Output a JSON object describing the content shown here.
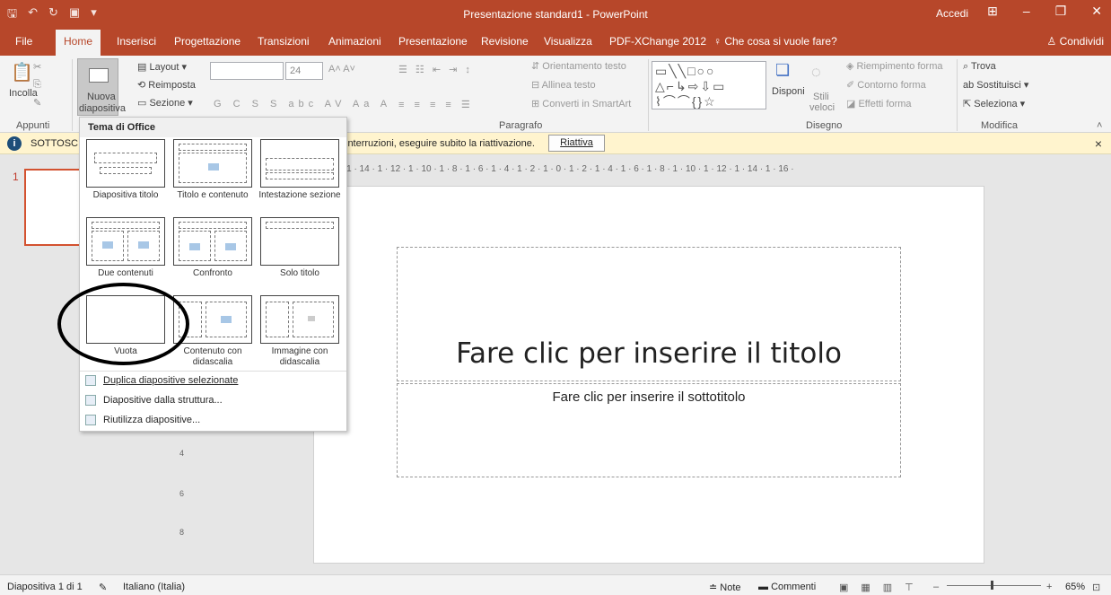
{
  "window": {
    "title": "Presentazione standard1 - PowerPoint",
    "signin": "Accedi"
  },
  "tabs": [
    "File",
    "Home",
    "Inserisci",
    "Progettazione",
    "Transizioni",
    "Animazioni",
    "Presentazione",
    "Revisione",
    "Visualizza",
    "PDF-XChange 2012",
    "Che cosa si vuole fare?"
  ],
  "share": "Condividi",
  "ribbon": {
    "paste": "Incolla",
    "new_slide_1": "Nuova",
    "new_slide_2": "diapositiva",
    "layout": "Layout",
    "reset": "Reimposta",
    "section": "Sezione",
    "font_size": "24",
    "text_dir": "Orientamento testo",
    "align_text": "Allinea testo",
    "smartart": "Converti in SmartArt",
    "arrange": "Disponi",
    "quick_styles_1": "Stili",
    "quick_styles_2": "veloci",
    "fill": "Riempimento forma",
    "outline": "Contorno forma",
    "effects": "Effetti forma",
    "find": "Trova",
    "replace": "Sostituisci",
    "select": "Seleziona",
    "groups": {
      "clipboard": "Appunti",
      "paragraph": "Paragrafo",
      "drawing": "Disegno",
      "editing": "Modifica"
    }
  },
  "message": {
    "label": "SOTTOSC",
    "text": "interruzioni, eseguire subito la riattivazione.",
    "button": "Riattiva"
  },
  "gallery": {
    "header": "Tema di Office",
    "layouts": [
      "Diapositiva titolo",
      "Titolo e contenuto",
      "Intestazione sezione",
      "Due contenuti",
      "Confronto",
      "Solo titolo",
      "Vuota",
      "Contenuto con didascalia",
      "Immagine con didascalia"
    ],
    "menu": [
      "Duplica diapositive selezionate",
      "Diapositive dalla struttura...",
      "Riutilizza diapositive..."
    ]
  },
  "thumbs": {
    "number": "1"
  },
  "ruler": {
    "h": "· 1 · 14 · 1 · 12 · 1 · 10 · 1 · 8 · 1 · 6 · 1 · 4 · 1 · 2 · 1 · 0 · 1 · 2 · 1 · 4 · 1 · 6 · 1 · 8 · 1 · 10 · 1 · 12 · 1 · 14 · 1 · 16 ·"
  },
  "slide": {
    "title_placeholder": "Fare clic per inserire il titolo",
    "subtitle_placeholder": "Fare clic per inserire il sottotitolo"
  },
  "status": {
    "slide": "Diapositiva 1 di 1",
    "language": "Italiano (Italia)",
    "notes": "Note",
    "comments": "Commenti",
    "zoom": "65%"
  }
}
